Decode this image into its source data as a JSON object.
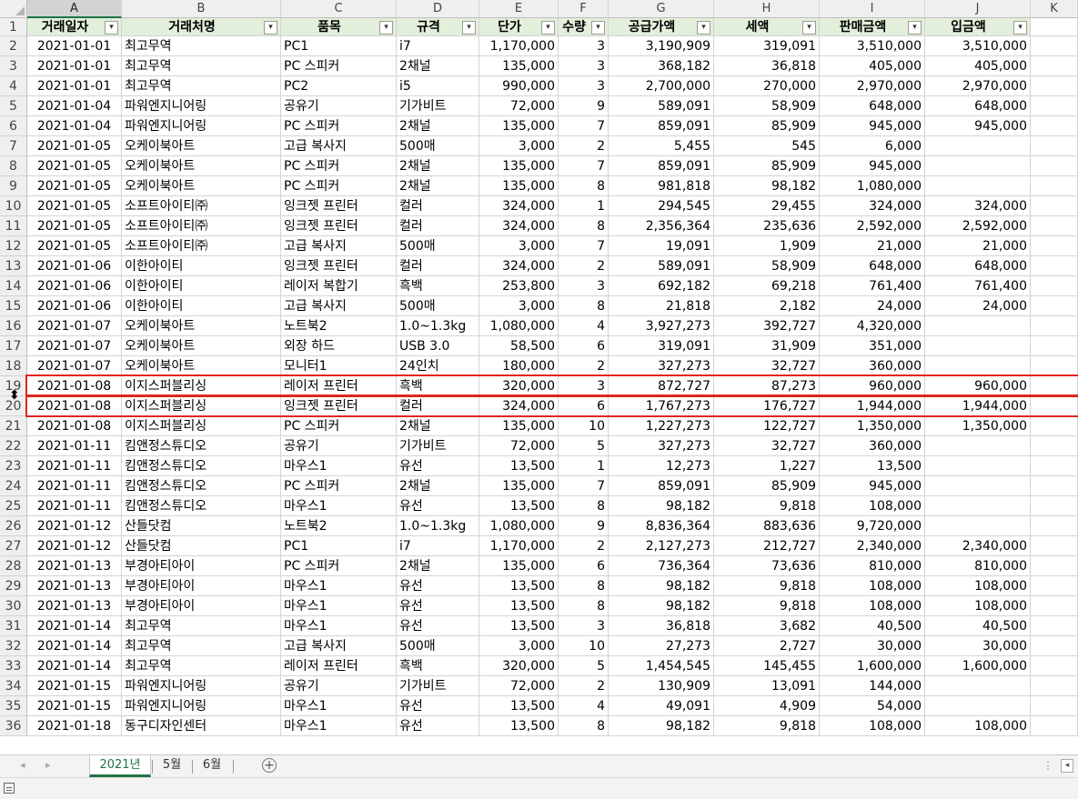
{
  "columns": [
    "A",
    "B",
    "C",
    "D",
    "E",
    "F",
    "G",
    "H",
    "I",
    "J",
    "K"
  ],
  "selected_column": "A",
  "headers": [
    "거래일자",
    "거래처명",
    "품목",
    "규격",
    "단가",
    "수량",
    "공급가액",
    "세액",
    "판매금액",
    "입금액"
  ],
  "filter_button_label": "▾",
  "rows": [
    [
      "2",
      "2021-01-01",
      "최고무역",
      "PC1",
      "i7",
      "1,170,000",
      "3",
      "3,190,909",
      "319,091",
      "3,510,000",
      "3,510,000"
    ],
    [
      "3",
      "2021-01-01",
      "최고무역",
      "PC 스피커",
      "2채널",
      "135,000",
      "3",
      "368,182",
      "36,818",
      "405,000",
      "405,000"
    ],
    [
      "4",
      "2021-01-01",
      "최고무역",
      "PC2",
      "i5",
      "990,000",
      "3",
      "2,700,000",
      "270,000",
      "2,970,000",
      "2,970,000"
    ],
    [
      "5",
      "2021-01-04",
      "파워엔지니어링",
      "공유기",
      "기가비트",
      "72,000",
      "9",
      "589,091",
      "58,909",
      "648,000",
      "648,000"
    ],
    [
      "6",
      "2021-01-04",
      "파워엔지니어링",
      "PC 스피커",
      "2채널",
      "135,000",
      "7",
      "859,091",
      "85,909",
      "945,000",
      "945,000"
    ],
    [
      "7",
      "2021-01-05",
      "오케이북아트",
      "고급 복사지",
      "500매",
      "3,000",
      "2",
      "5,455",
      "545",
      "6,000",
      ""
    ],
    [
      "8",
      "2021-01-05",
      "오케이북아트",
      "PC 스피커",
      "2채널",
      "135,000",
      "7",
      "859,091",
      "85,909",
      "945,000",
      ""
    ],
    [
      "9",
      "2021-01-05",
      "오케이북아트",
      "PC 스피커",
      "2채널",
      "135,000",
      "8",
      "981,818",
      "98,182",
      "1,080,000",
      ""
    ],
    [
      "10",
      "2021-01-05",
      "소프트아이티㈜",
      "잉크젯 프린터",
      "컬러",
      "324,000",
      "1",
      "294,545",
      "29,455",
      "324,000",
      "324,000"
    ],
    [
      "11",
      "2021-01-05",
      "소프트아이티㈜",
      "잉크젯 프린터",
      "컬러",
      "324,000",
      "8",
      "2,356,364",
      "235,636",
      "2,592,000",
      "2,592,000"
    ],
    [
      "12",
      "2021-01-05",
      "소프트아이티㈜",
      "고급 복사지",
      "500매",
      "3,000",
      "7",
      "19,091",
      "1,909",
      "21,000",
      "21,000"
    ],
    [
      "13",
      "2021-01-06",
      "이한아이티",
      "잉크젯 프린터",
      "컬러",
      "324,000",
      "2",
      "589,091",
      "58,909",
      "648,000",
      "648,000"
    ],
    [
      "14",
      "2021-01-06",
      "이한아이티",
      "레이저 복합기",
      "흑백",
      "253,800",
      "3",
      "692,182",
      "69,218",
      "761,400",
      "761,400"
    ],
    [
      "15",
      "2021-01-06",
      "이한아이티",
      "고급 복사지",
      "500매",
      "3,000",
      "8",
      "21,818",
      "2,182",
      "24,000",
      "24,000"
    ],
    [
      "16",
      "2021-01-07",
      "오케이북아트",
      "노트북2",
      "1.0~1.3kg",
      "1,080,000",
      "4",
      "3,927,273",
      "392,727",
      "4,320,000",
      ""
    ],
    [
      "17",
      "2021-01-07",
      "오케이북아트",
      "외장 하드",
      "USB 3.0",
      "58,500",
      "6",
      "319,091",
      "31,909",
      "351,000",
      ""
    ],
    [
      "18",
      "2021-01-07",
      "오케이북아트",
      "모니터1",
      "24인치",
      "180,000",
      "2",
      "327,273",
      "32,727",
      "360,000",
      ""
    ],
    [
      "19",
      "2021-01-08",
      "이지스퍼블리싱",
      "레이저 프린터",
      "흑백",
      "320,000",
      "3",
      "872,727",
      "87,273",
      "960,000",
      "960,000"
    ],
    [
      "20",
      "2021-01-08",
      "이지스퍼블리싱",
      "잉크젯 프린터",
      "컬러",
      "324,000",
      "6",
      "1,767,273",
      "176,727",
      "1,944,000",
      "1,944,000"
    ],
    [
      "21",
      "2021-01-08",
      "이지스퍼블리싱",
      "PC 스피커",
      "2채널",
      "135,000",
      "10",
      "1,227,273",
      "122,727",
      "1,350,000",
      "1,350,000"
    ],
    [
      "22",
      "2021-01-11",
      "킴앤정스튜디오",
      "공유기",
      "기가비트",
      "72,000",
      "5",
      "327,273",
      "32,727",
      "360,000",
      ""
    ],
    [
      "23",
      "2021-01-11",
      "킴앤정스튜디오",
      "마우스1",
      "유선",
      "13,500",
      "1",
      "12,273",
      "1,227",
      "13,500",
      ""
    ],
    [
      "24",
      "2021-01-11",
      "킴앤정스튜디오",
      "PC 스피커",
      "2채널",
      "135,000",
      "7",
      "859,091",
      "85,909",
      "945,000",
      ""
    ],
    [
      "25",
      "2021-01-11",
      "킴앤정스튜디오",
      "마우스1",
      "유선",
      "13,500",
      "8",
      "98,182",
      "9,818",
      "108,000",
      ""
    ],
    [
      "26",
      "2021-01-12",
      "산들닷컴",
      "노트북2",
      "1.0~1.3kg",
      "1,080,000",
      "9",
      "8,836,364",
      "883,636",
      "9,720,000",
      ""
    ],
    [
      "27",
      "2021-01-12",
      "산들닷컴",
      "PC1",
      "i7",
      "1,170,000",
      "2",
      "2,127,273",
      "212,727",
      "2,340,000",
      "2,340,000"
    ],
    [
      "28",
      "2021-01-13",
      "부경아티아이",
      "PC 스피커",
      "2채널",
      "135,000",
      "6",
      "736,364",
      "73,636",
      "810,000",
      "810,000"
    ],
    [
      "29",
      "2021-01-13",
      "부경아티아이",
      "마우스1",
      "유선",
      "13,500",
      "8",
      "98,182",
      "9,818",
      "108,000",
      "108,000"
    ],
    [
      "30",
      "2021-01-13",
      "부경아티아이",
      "마우스1",
      "유선",
      "13,500",
      "8",
      "98,182",
      "9,818",
      "108,000",
      "108,000"
    ],
    [
      "31",
      "2021-01-14",
      "최고무역",
      "마우스1",
      "유선",
      "13,500",
      "3",
      "36,818",
      "3,682",
      "40,500",
      "40,500"
    ],
    [
      "32",
      "2021-01-14",
      "최고무역",
      "고급 복사지",
      "500매",
      "3,000",
      "10",
      "27,273",
      "2,727",
      "30,000",
      "30,000"
    ],
    [
      "33",
      "2021-01-14",
      "최고무역",
      "레이저 프린터",
      "흑백",
      "320,000",
      "5",
      "1,454,545",
      "145,455",
      "1,600,000",
      "1,600,000"
    ],
    [
      "34",
      "2021-01-15",
      "파워엔지니어링",
      "공유기",
      "기가비트",
      "72,000",
      "2",
      "130,909",
      "13,091",
      "144,000",
      ""
    ],
    [
      "35",
      "2021-01-15",
      "파워엔지니어링",
      "마우스1",
      "유선",
      "13,500",
      "4",
      "49,091",
      "4,909",
      "54,000",
      ""
    ],
    [
      "36",
      "2021-01-18",
      "동구디자인센터",
      "마우스1",
      "유선",
      "13,500",
      "8",
      "98,182",
      "9,818",
      "108,000",
      "108,000"
    ]
  ],
  "header_row_number": "1",
  "highlighted_rows": [
    "19",
    "20"
  ],
  "sheet_tabs": [
    {
      "label": "2021년",
      "active": true
    },
    {
      "label": "5월",
      "active": false
    },
    {
      "label": "6월",
      "active": false
    }
  ],
  "icons": {
    "prev_sheet": "◂",
    "next_sheet": "▸",
    "add_sheet": "+",
    "more": "⋮",
    "scroll_left": "◂",
    "row_resize_cursor": "⬍"
  },
  "colors": {
    "header_fill": "#e2efda",
    "highlight_border": "#e0261f",
    "accent": "#217346"
  }
}
